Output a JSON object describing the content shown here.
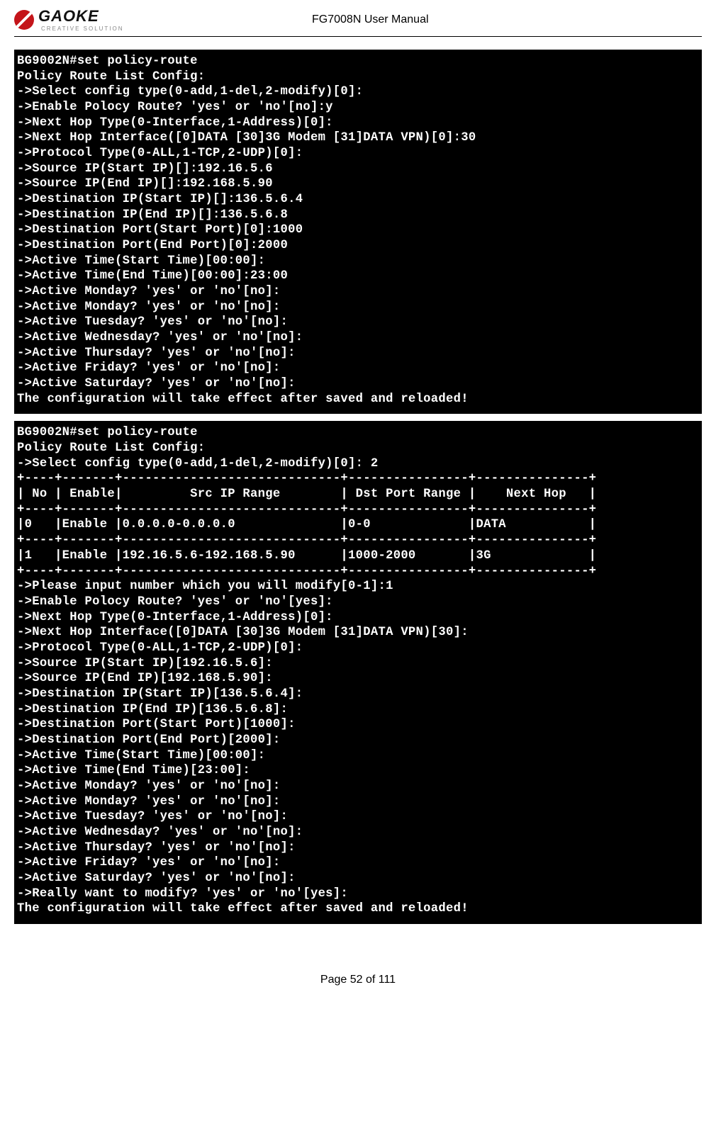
{
  "header": {
    "brand": "GAOKE",
    "tagline": "CREATIVE SOLUTION",
    "doc_title": "FG7008N User Manual"
  },
  "terminal1": {
    "lines": [
      "BG9002N#set policy-route",
      "Policy Route List Config:",
      "->Select config type(0-add,1-del,2-modify)[0]:",
      "->Enable Polocy Route? 'yes' or 'no'[no]:y",
      "->Next Hop Type(0-Interface,1-Address)[0]:",
      "->Next Hop Interface([0]DATA [30]3G Modem [31]DATA VPN)[0]:30",
      "->Protocol Type(0-ALL,1-TCP,2-UDP)[0]:",
      "->Source IP(Start IP)[]:192.16.5.6",
      "->Source IP(End IP)[]:192.168.5.90",
      "->Destination IP(Start IP)[]:136.5.6.4",
      "->Destination IP(End IP)[]:136.5.6.8",
      "->Destination Port(Start Port)[0]:1000",
      "->Destination Port(End Port)[0]:2000",
      "->Active Time(Start Time)[00:00]:",
      "->Active Time(End Time)[00:00]:23:00",
      "->Active Monday? 'yes' or 'no'[no]:",
      "->Active Monday? 'yes' or 'no'[no]:",
      "->Active Tuesday? 'yes' or 'no'[no]:",
      "->Active Wednesday? 'yes' or 'no'[no]:",
      "->Active Thursday? 'yes' or 'no'[no]:",
      "->Active Friday? 'yes' or 'no'[no]:",
      "->Active Saturday? 'yes' or 'no'[no]:",
      "The configuration will take effect after saved and reloaded!"
    ]
  },
  "terminal2": {
    "prelines": [
      "BG9002N#set policy-route",
      "Policy Route List Config:",
      "->Select config type(0-add,1-del,2-modify)[0]: 2"
    ],
    "table": {
      "sep": "+----+-------+-----------------------------+----------------+---------------+",
      "head": "| No | Enable|         Src IP Range        | Dst Port Range |    Next Hop   |",
      "rows": [
        "|0   |Enable |0.0.0.0-0.0.0.0              |0-0             |DATA           |",
        "|1   |Enable |192.16.5.6-192.168.5.90      |1000-2000       |3G             |"
      ]
    },
    "postlines": [
      "->Please input number which you will modify[0-1]:1",
      "->Enable Polocy Route? 'yes' or 'no'[yes]:",
      "->Next Hop Type(0-Interface,1-Address)[0]:",
      "->Next Hop Interface([0]DATA [30]3G Modem [31]DATA VPN)[30]:",
      "->Protocol Type(0-ALL,1-TCP,2-UDP)[0]:",
      "->Source IP(Start IP)[192.16.5.6]:",
      "->Source IP(End IP)[192.168.5.90]:",
      "->Destination IP(Start IP)[136.5.6.4]:",
      "->Destination IP(End IP)[136.5.6.8]:",
      "->Destination Port(Start Port)[1000]:",
      "->Destination Port(End Port)[2000]:",
      "->Active Time(Start Time)[00:00]:",
      "->Active Time(End Time)[23:00]:",
      "->Active Monday? 'yes' or 'no'[no]:",
      "->Active Monday? 'yes' or 'no'[no]:",
      "->Active Tuesday? 'yes' or 'no'[no]:",
      "->Active Wednesday? 'yes' or 'no'[no]:",
      "->Active Thursday? 'yes' or 'no'[no]:",
      "->Active Friday? 'yes' or 'no'[no]:",
      "->Active Saturday? 'yes' or 'no'[no]:",
      "->Really want to modify? 'yes' or 'no'[yes]:",
      "The configuration will take effect after saved and reloaded!"
    ]
  },
  "footer": {
    "page": "Page 52 of 111"
  }
}
